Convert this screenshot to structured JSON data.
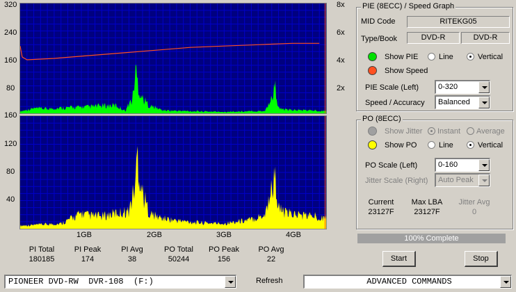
{
  "colors": {
    "background": "#d4d0c8",
    "plot_bg": "#000080",
    "grid": "#0000c8",
    "pie": "#00ff00",
    "speed": "#ff5020",
    "po": "#ffff00"
  },
  "top_chart": {
    "left_ticks": [
      "320",
      "240",
      "160",
      "80",
      "160"
    ],
    "right_ticks": [
      "8x",
      "6x",
      "4x",
      "2x"
    ]
  },
  "bottom_chart": {
    "left_ticks": [
      "120",
      "80",
      "40"
    ],
    "x_ticks": [
      "1GB",
      "2GB",
      "3GB",
      "4GB"
    ]
  },
  "chart_data": [
    {
      "type": "area",
      "series": [
        {
          "name": "PIE",
          "x": [
            0,
            0.1,
            0.2,
            0.4,
            0.6,
            0.8,
            1.0,
            1.2,
            1.4,
            1.55,
            1.6,
            1.65,
            1.7,
            1.75,
            1.8,
            1.9,
            2.0,
            2.1,
            2.3,
            2.6,
            3.0,
            3.4,
            3.6,
            3.7,
            3.75,
            3.8,
            3.9,
            4.2,
            4.5
          ],
          "values": [
            8,
            14,
            20,
            18,
            22,
            24,
            26,
            30,
            32,
            10,
            40,
            52,
            174,
            90,
            60,
            30,
            22,
            12,
            10,
            8,
            6,
            8,
            10,
            60,
            110,
            20,
            14,
            12,
            10
          ]
        },
        {
          "name": "Speed",
          "x": [
            0,
            0.03,
            0.1,
            0.5,
            1.0,
            1.5,
            2.0,
            2.5,
            3.0,
            3.5,
            4.0,
            4.4
          ],
          "values": [
            4.9,
            4.1,
            3.9,
            4.0,
            4.2,
            4.4,
            4.6,
            4.8,
            4.9,
            5.0,
            5.1,
            5.1
          ]
        }
      ],
      "ylim": [
        0,
        320
      ],
      "y2lim": [
        0,
        8
      ]
    },
    {
      "type": "area",
      "series": [
        {
          "name": "PO",
          "x": [
            0,
            0.3,
            0.6,
            0.9,
            1.0,
            1.2,
            1.4,
            1.6,
            1.7,
            1.72,
            1.75,
            1.8,
            1.9,
            2.0,
            2.1,
            2.3,
            2.6,
            3.0,
            3.4,
            3.6,
            3.7,
            3.75,
            3.8,
            3.9,
            4.2,
            4.5
          ],
          "values": [
            6,
            8,
            10,
            30,
            26,
            24,
            30,
            34,
            90,
            156,
            110,
            70,
            30,
            24,
            20,
            16,
            12,
            10,
            18,
            28,
            80,
            100,
            40,
            30,
            26,
            22
          ]
        }
      ],
      "ylim": [
        0,
        160
      ]
    }
  ],
  "stats": [
    {
      "label": "PI Total",
      "value": "180185"
    },
    {
      "label": "PI Peak",
      "value": "174"
    },
    {
      "label": "PI Avg",
      "value": "38"
    },
    {
      "label": "PO Total",
      "value": "50244"
    },
    {
      "label": "PO Peak",
      "value": "156"
    },
    {
      "label": "PO Avg",
      "value": "22"
    }
  ],
  "pie_group": {
    "title": "PIE (8ECC) / Speed Graph",
    "mid_code_label": "MID Code",
    "mid_code_value": "RITEKG05",
    "type_book_label": "Type/Book",
    "type_value": "DVD-R",
    "book_value": "DVD-R",
    "show_pie": "Show PIE",
    "line": "Line",
    "vertical": "Vertical",
    "show_speed": "Show Speed",
    "pie_scale_label": "PIE Scale (Left)",
    "pie_scale_value": "0-320",
    "speed_accuracy_label": "Speed / Accuracy",
    "speed_accuracy_value": "Balanced"
  },
  "po_group": {
    "title": "PO (8ECC)",
    "show_jitter": "Show Jitter",
    "instant": "Instant",
    "average": "Average",
    "show_po": "Show PO",
    "line": "Line",
    "vertical": "Vertical",
    "po_scale_label": "PO Scale (Left)",
    "po_scale_value": "0-160",
    "jitter_scale_label": "Jitter Scale (Right)",
    "jitter_scale_value": "Auto Peak",
    "current_label": "Current",
    "current_value": "23127F",
    "max_lba_label": "Max LBA",
    "max_lba_value": "23127F",
    "jitter_avg_label": "Jitter Avg",
    "jitter_avg_value": "0"
  },
  "progress": {
    "text": "100% Complete",
    "percent": 100
  },
  "buttons": {
    "start": "Start",
    "stop": "Stop",
    "refresh": "Refresh"
  },
  "drive_select": "PIONEER DVD-RW  DVR-108  (F:)",
  "advanced_commands": "ADVANCED COMMANDS"
}
